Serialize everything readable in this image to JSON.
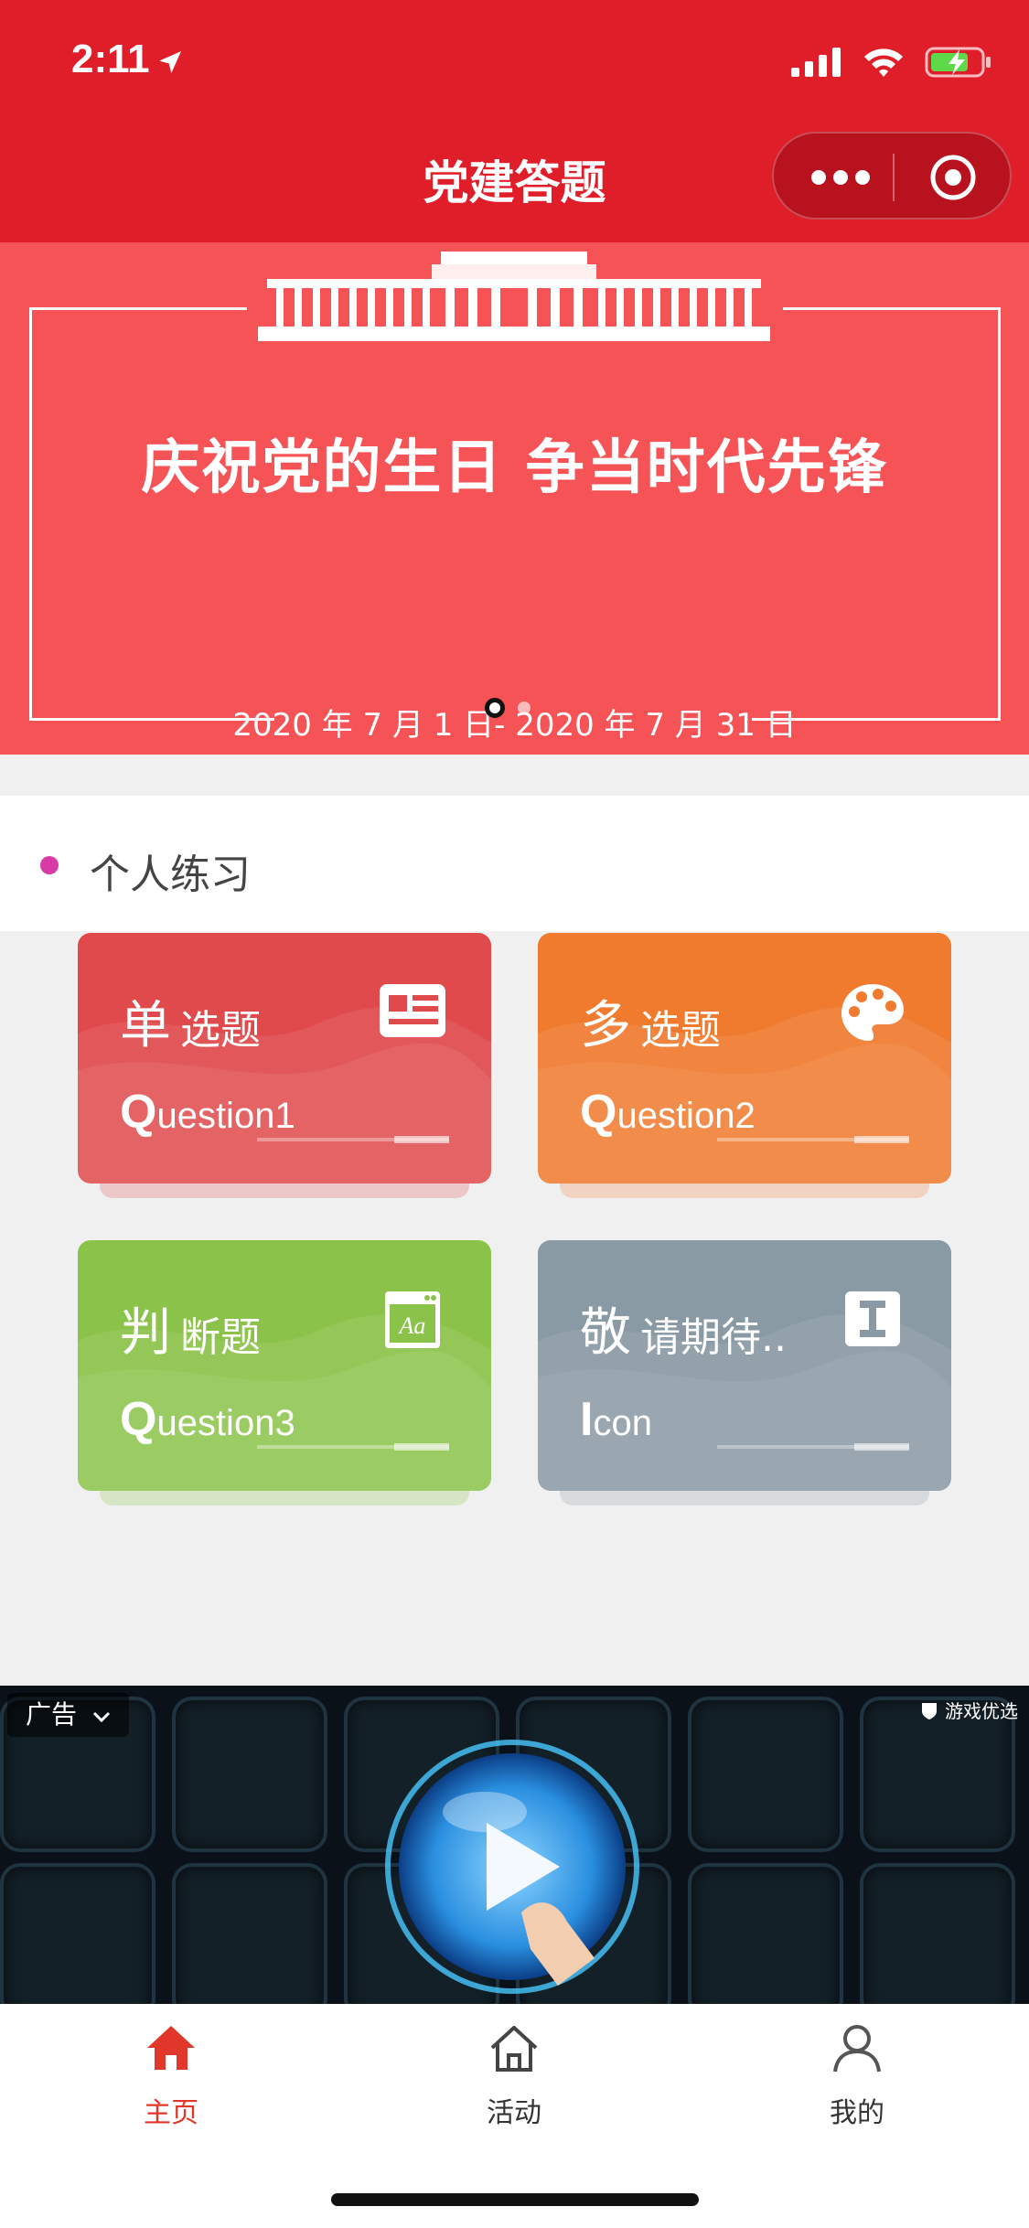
{
  "status_bar": {
    "time": "2:11"
  },
  "nav": {
    "title": "党建答题"
  },
  "banner": {
    "title": "庆祝党的生日 争当时代先锋",
    "date_range": "2020 年 7 月 1 日- 2020 年 7 月 31 日"
  },
  "section": {
    "title": "个人练习"
  },
  "cards": [
    {
      "big": "单",
      "small": "选题",
      "sub_initial": "Q",
      "sub_rest": "uestion1",
      "color": "#e04a4c",
      "icon": "newspaper-icon"
    },
    {
      "big": "多",
      "small": "选题",
      "sub_initial": "Q",
      "sub_rest": "uestion2",
      "color": "#f07a2e",
      "icon": "palette-icon"
    },
    {
      "big": "判",
      "small": "断题",
      "sub_initial": "Q",
      "sub_rest": "uestion3",
      "color": "#8bc34a",
      "icon": "font-window-icon"
    },
    {
      "big": "敬",
      "small": "请期待..",
      "sub_initial": "I",
      "sub_rest": "con",
      "color": "#8a9aa4",
      "icon": "text-cursor-icon"
    }
  ],
  "ad": {
    "label": "广告",
    "brand": "游戏优选"
  },
  "tabbar": {
    "items": [
      {
        "label": "主页",
        "icon": "home-icon",
        "active": true
      },
      {
        "label": "活动",
        "icon": "house-outline-icon",
        "active": false
      },
      {
        "label": "我的",
        "icon": "user-icon",
        "active": false
      }
    ],
    "active_color": "#e0372a",
    "inactive_color": "#333333"
  }
}
